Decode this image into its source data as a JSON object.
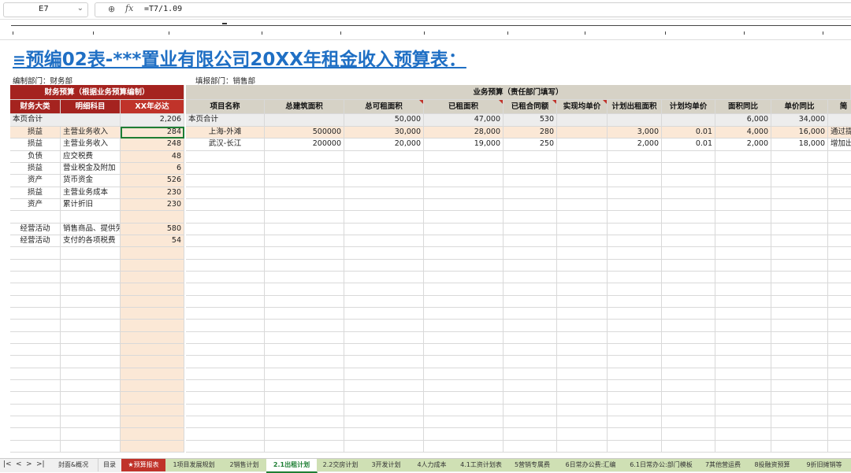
{
  "formula_bar": {
    "cell_ref": "E7",
    "formula": "=T7/1.09"
  },
  "title": "预编02表-***置业有限公司20XX年租金收入预算表：",
  "meta": {
    "compiler": "编制部门：财务部",
    "filler": "填报部门：销售部"
  },
  "left_panel": {
    "section_header": "财务预算（根据业务预算编制）",
    "columns": [
      "财务大类",
      "明细科目",
      "XX年必达"
    ],
    "total": {
      "label": "本页合计",
      "value": "2,206"
    },
    "rows": [
      {
        "cat": "损益",
        "item": "主营业务收入",
        "value": "284"
      },
      {
        "cat": "损益",
        "item": "主营业务收入",
        "value": "248"
      },
      {
        "cat": "负债",
        "item": "应交税费",
        "value": "48"
      },
      {
        "cat": "损益",
        "item": "营业税金及附加",
        "value": "6"
      },
      {
        "cat": "资产",
        "item": "货币资金",
        "value": "526"
      },
      {
        "cat": "损益",
        "item": "主营业务成本",
        "value": "230"
      },
      {
        "cat": "资产",
        "item": "累计折旧",
        "value": "230"
      },
      {
        "cat": "",
        "item": "",
        "value": ""
      },
      {
        "cat": "经营活动",
        "item": "销售商品、提供劳",
        "value": "580"
      },
      {
        "cat": "经营活动",
        "item": "支付的各项税费",
        "value": "54"
      }
    ]
  },
  "right_panel": {
    "section_header": "业务预算（责任部门填写）",
    "columns": [
      "项目名称",
      "总建筑面积",
      "总可租面积",
      "已租面积",
      "已租合同额",
      "实现均单价",
      "计划出租面积",
      "计划均单价",
      "面积同比",
      "单价同比",
      "简"
    ],
    "total": {
      "label": "本页合计",
      "values": [
        "",
        "50,000",
        "47,000",
        "530",
        "",
        "",
        "",
        "6,000",
        "34,000",
        ""
      ]
    },
    "rows": [
      {
        "name": "上海-外滩",
        "values": [
          "500000",
          "30,000",
          "28,000",
          "280",
          "",
          "3,000",
          "0.01",
          "4,000",
          "16,000",
          "通过提"
        ]
      },
      {
        "name": "武汉-长江",
        "values": [
          "200000",
          "20,000",
          "19,000",
          "250",
          "",
          "2,000",
          "0.01",
          "2,000",
          "18,000",
          "增加出"
        ]
      }
    ]
  },
  "sheet_tabs": {
    "nav": [
      "|<",
      "<",
      ">",
      ">|"
    ],
    "items": [
      "封面&概况",
      "目录",
      "★预算报表",
      "1项目发展规划",
      "2销售计划",
      "2.1出租计划",
      "2.2交房计划",
      "3开发计划",
      "4人力成本",
      "4.1工资计划表",
      "5营销专属费",
      "6日常办公费:汇编",
      "6.1日常办公:部门模板",
      "7其他营运费",
      "8投融资预算",
      "9折旧摊销等"
    ]
  }
}
